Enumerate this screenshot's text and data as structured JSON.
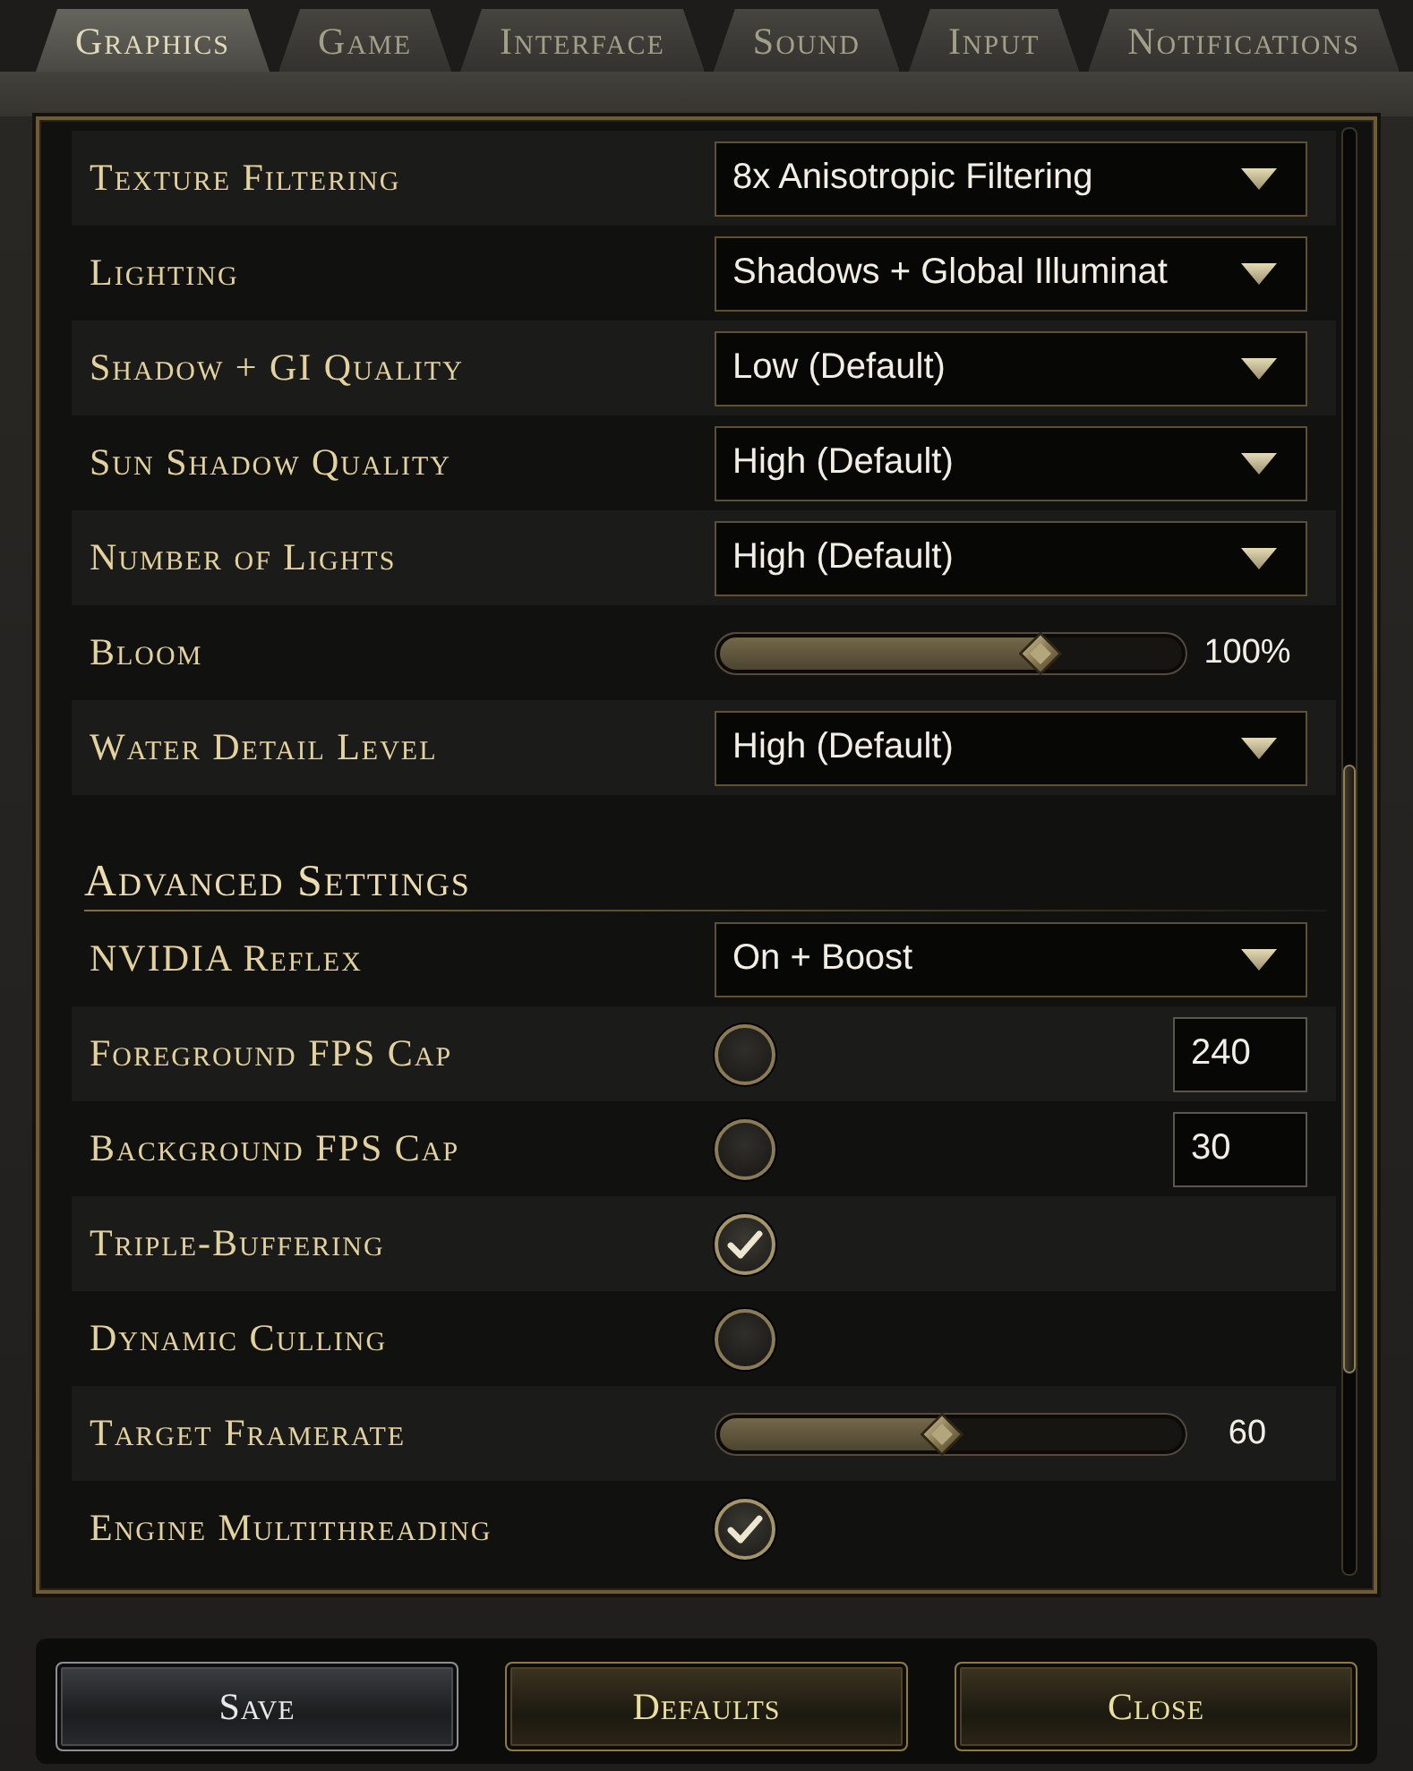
{
  "tabs": [
    {
      "label": "Graphics",
      "selected": true
    },
    {
      "label": "Game",
      "selected": false
    },
    {
      "label": "Interface",
      "selected": false
    },
    {
      "label": "Sound",
      "selected": false
    },
    {
      "label": "Input",
      "selected": false
    },
    {
      "label": "Notifications",
      "selected": false
    }
  ],
  "settings": [
    {
      "kind": "dropdown",
      "label": "Texture Filtering",
      "value": "8x Anisotropic Filtering"
    },
    {
      "kind": "dropdown",
      "label": "Lighting",
      "value": "Shadows + Global Illuminat"
    },
    {
      "kind": "dropdown",
      "label": "Shadow + GI Quality",
      "value": "Low (Default)"
    },
    {
      "kind": "dropdown",
      "label": "Sun Shadow Quality",
      "value": "High (Default)"
    },
    {
      "kind": "dropdown",
      "label": "Number of Lights",
      "value": "High (Default)"
    },
    {
      "kind": "slider",
      "label": "Bloom",
      "level": 0.69,
      "reading": "100%"
    },
    {
      "kind": "dropdown",
      "label": "Water Detail Level",
      "value": "High (Default)"
    }
  ],
  "advanced": {
    "title": "Advanced Settings",
    "settings": [
      {
        "kind": "dropdown",
        "label": "NVIDIA Reflex",
        "value": "On + Boost"
      },
      {
        "kind": "checkbox_number",
        "label": "Foreground FPS Cap",
        "checked": false,
        "value": "240"
      },
      {
        "kind": "checkbox_number",
        "label": "Background FPS Cap",
        "checked": false,
        "value": "30"
      },
      {
        "kind": "checkbox",
        "label": "Triple-Buffering",
        "checked": true
      },
      {
        "kind": "checkbox",
        "label": "Dynamic Culling",
        "checked": false
      },
      {
        "kind": "slider",
        "label": "Target Framerate",
        "level": 0.48,
        "reading": "60"
      },
      {
        "kind": "checkbox",
        "label": "Engine Multithreading",
        "checked": true
      }
    ]
  },
  "buttons": [
    {
      "label": "Save",
      "disabled": true
    },
    {
      "label": "Defaults",
      "disabled": false
    },
    {
      "label": "Close",
      "disabled": false
    }
  ]
}
